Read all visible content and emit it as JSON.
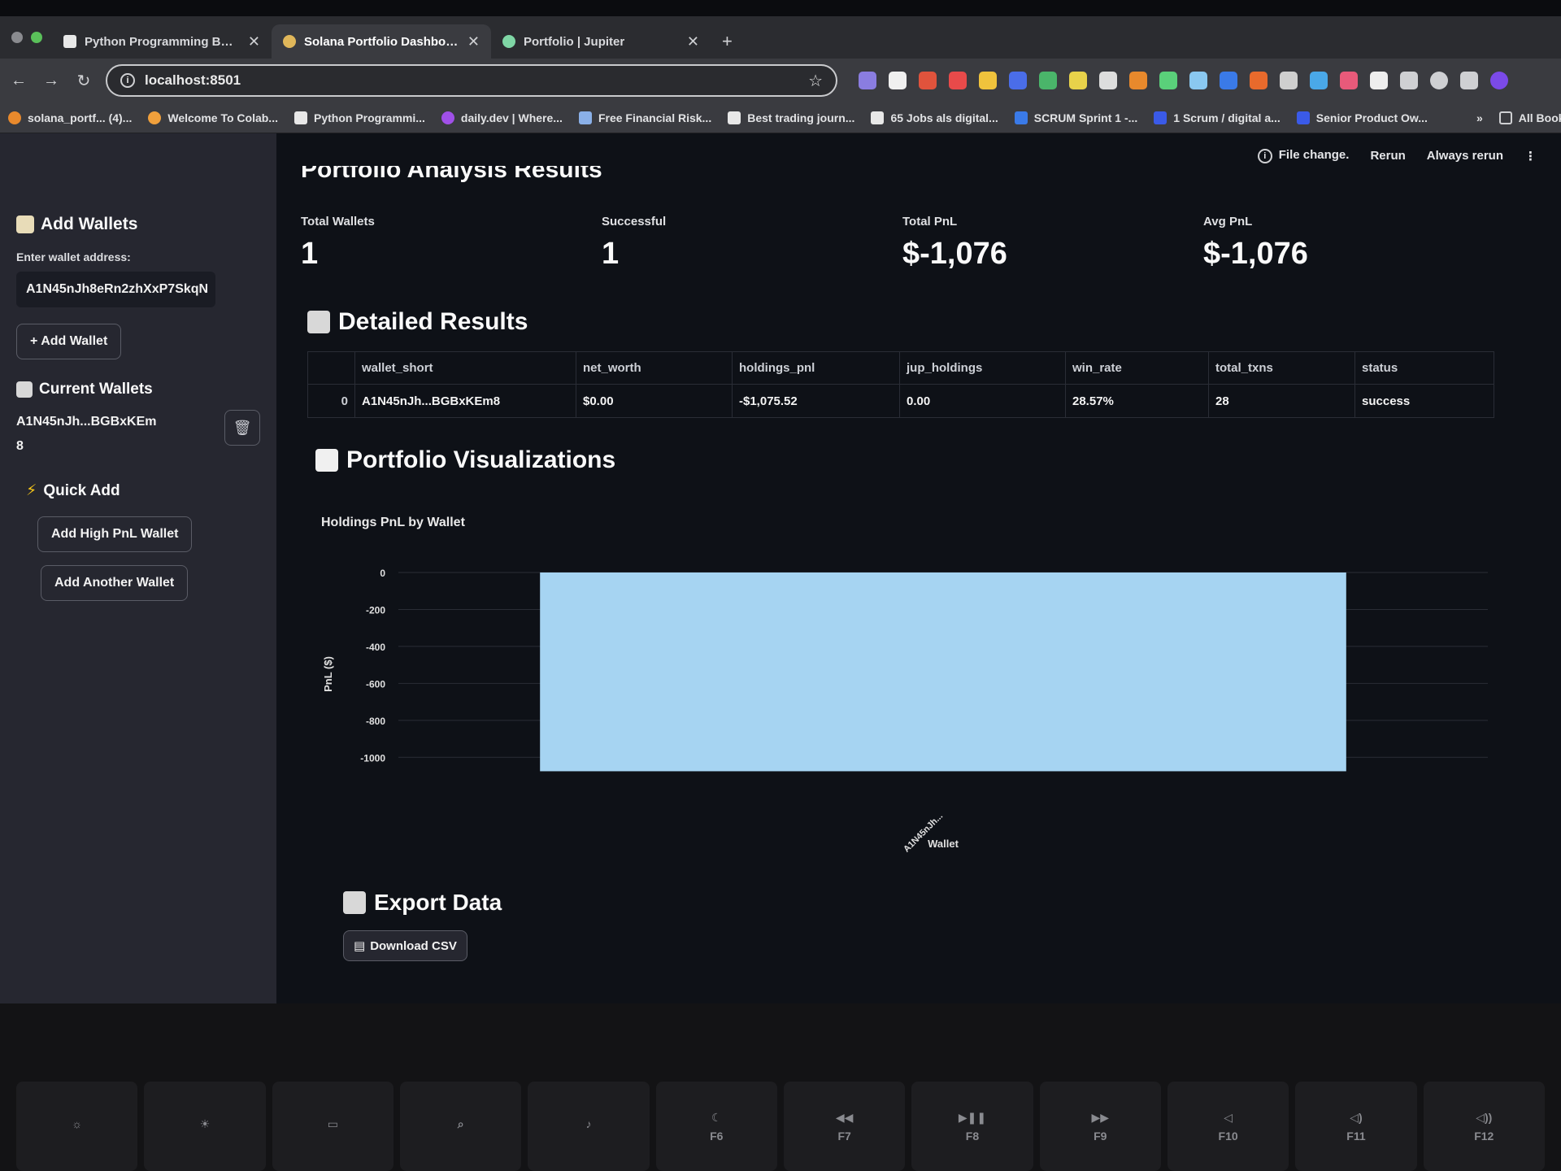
{
  "browser": {
    "tabs": [
      {
        "label": "Python Programming Bootcamp",
        "active": false
      },
      {
        "label": "Solana Portfolio Dashboard",
        "active": true
      },
      {
        "label": "Portfolio | Jupiter",
        "active": false
      }
    ],
    "url": "localhost:8501",
    "bookmarks": [
      "solana_portf... (4)...",
      "Welcome To Colab...",
      "Python Programmi...",
      "daily.dev | Where...",
      "Free Financial Risk...",
      "Best trading journ...",
      "65 Jobs als digital...",
      "SCRUM Sprint 1 -...",
      "1 Scrum / digital a...",
      "Senior Product Ow..."
    ],
    "all_bookmarks": "All Bookmarks"
  },
  "header": {
    "file_change": "File change.",
    "rerun": "Rerun",
    "always_rerun": "Always rerun"
  },
  "sidebar": {
    "add_wallets_title": "Add Wallets",
    "input_label": "Enter wallet address:",
    "input_value": "A1N45nJh8eRn2zhXxP7SkqN",
    "add_wallet_button": "+ Add Wallet",
    "current_wallets_title": "Current Wallets",
    "current_wallet": "A1N45nJh...BGBxKEm8",
    "quick_add_title": "Quick Add",
    "quick_add_high": "Add High PnL Wallet",
    "quick_add_another": "Add Another Wallet"
  },
  "main": {
    "partial_title": "Portfolio Analysis Results",
    "metrics": [
      {
        "label": "Total Wallets",
        "value": "1"
      },
      {
        "label": "Successful",
        "value": "1"
      },
      {
        "label": "Total PnL",
        "value": "$-1,076"
      },
      {
        "label": "Avg PnL",
        "value": "$-1,076"
      }
    ],
    "detailed_title": "Detailed Results",
    "table": {
      "columns": [
        "",
        "wallet_short",
        "net_worth",
        "holdings_pnl",
        "jup_holdings",
        "win_rate",
        "total_txns",
        "status"
      ],
      "rows": [
        [
          "0",
          "A1N45nJh...BGBxKEm8",
          "$0.00",
          "-$1,075.52",
          "0.00",
          "28.57%",
          "28",
          "success"
        ]
      ]
    },
    "viz_title": "Portfolio Visualizations",
    "export_title": "Export Data",
    "download_button": "Download CSV"
  },
  "chart_data": {
    "type": "bar",
    "title": "Holdings PnL by Wallet",
    "xlabel": "Wallet",
    "ylabel": "PnL ($)",
    "categories": [
      "A1N45nJh..."
    ],
    "values": [
      -1075.52
    ],
    "ylim": [
      -1100,
      0
    ],
    "yticks": [
      0,
      -200,
      -400,
      -600,
      -800,
      -1000
    ],
    "grid": true,
    "color": "#a6d4f2"
  },
  "keyboard": {
    "keys": [
      "",
      "",
      "",
      "",
      "",
      "F6",
      "F7",
      "F8",
      "F9",
      "F10",
      "F11",
      "F12"
    ]
  },
  "colors": {
    "app_bg": "#0e1117",
    "sidebar_bg": "#262730",
    "bar": "#a6d4f2"
  }
}
